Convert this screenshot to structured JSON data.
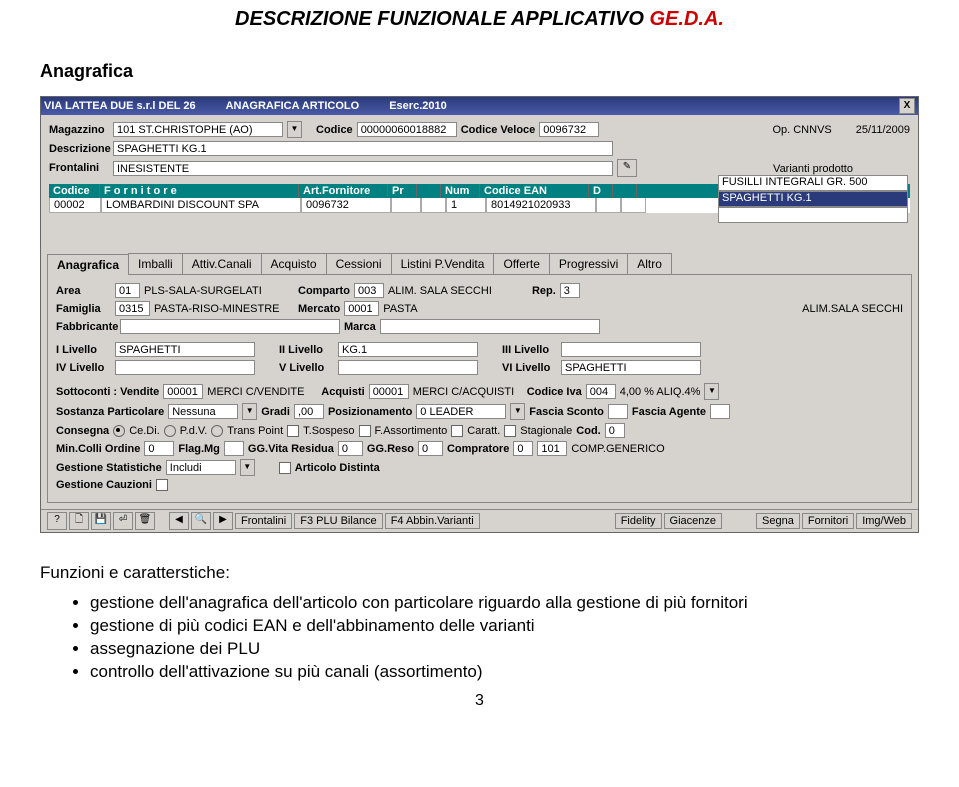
{
  "doc": {
    "title_plain": "DESCRIZIONE FUNZIONALE APPLICATIVO ",
    "title_em": "GE.D.A."
  },
  "section": "Anagrafica",
  "titlebar": {
    "company": "VIA LATTEA DUE s.r.l DEL 26",
    "module": "ANAGRAFICA ARTICOLO",
    "eserc": "Eserc.2010",
    "close": "X"
  },
  "top": {
    "magazzino_lbl": "Magazzino",
    "magazzino": "101 ST.CHRISTOPHE (AO)",
    "codice_lbl": "Codice",
    "codice": "00000060018882",
    "codvel_lbl": "Codice Veloce",
    "codvel": "0096732",
    "op": "Op. CNNVS",
    "data": "25/11/2009",
    "descr_lbl": "Descrizione",
    "descr": "SPAGHETTI KG.1",
    "front_lbl": "Frontalini",
    "front": "INESISTENTE",
    "edit": "✎"
  },
  "forntbl": {
    "h": [
      "Codice",
      "F o r n i t o r e",
      "Art.Fornitore",
      "Pr",
      "",
      "Num",
      "Codice EAN",
      "D",
      ""
    ],
    "r": [
      "00002",
      "LOMBARDINI DISCOUNT SPA",
      "0096732",
      "",
      "",
      "1",
      "8014921020933",
      "",
      ""
    ]
  },
  "variants": {
    "title": "Varianti prodotto",
    "items": [
      "FUSILLI INTEGRALI GR. 500",
      "SPAGHETTI KG.1"
    ]
  },
  "tabs": [
    "Anagrafica",
    "Imballi",
    "Attiv.Canali",
    "Acquisto",
    "Cessioni",
    "Listini P.Vendita",
    "Offerte",
    "Progressivi",
    "Altro"
  ],
  "panel": {
    "area_lbl": "Area",
    "area_c": "01",
    "area_d": "PLS-SALA-SURGELATI",
    "comp_lbl": "Comparto",
    "comp_c": "003",
    "comp_d": "ALIM. SALA SECCHI",
    "rep_lbl": "Rep.",
    "rep_c": "3",
    "fam_lbl": "Famiglia",
    "fam_c": "0315",
    "fam_d": "PASTA-RISO-MINESTRE",
    "merc_lbl": "Mercato",
    "merc_c": "0001",
    "merc_d": "PASTA",
    "rep_d": "ALIM.SALA SECCHI",
    "fabb_lbl": "Fabbricante",
    "marca_lbl": "Marca",
    "l1_lbl": "I Livello",
    "l1": "SPAGHETTI",
    "l2_lbl": "II Livello",
    "l2": "KG.1",
    "l3_lbl": "III Livello",
    "l3": "",
    "l4_lbl": "IV Livello",
    "l4": "",
    "l5_lbl": "V Livello",
    "l5": "",
    "l6_lbl": "VI Livello",
    "l6": "SPAGHETTI",
    "sott_lbl": "Sottoconti : Vendite",
    "sott_v_c": "00001",
    "sott_v_d": "MERCI C/VENDITE",
    "acq_lbl": "Acquisti",
    "acq_c": "00001",
    "acq_d": "MERCI C/ACQUISTI",
    "iva_lbl": "Codice Iva",
    "iva_c": "004",
    "iva_d": "4,00 % ALIQ.4%",
    "sost_lbl": "Sostanza Particolare",
    "sost": "Nessuna",
    "gradi_lbl": "Gradi",
    "gradi": ",00",
    "pos_lbl": "Posizionamento",
    "pos": "0 LEADER",
    "fsc_lbl": "Fascia Sconto",
    "fag_lbl": "Fascia Agente",
    "cons_lbl": "Consegna",
    "r1": "Ce.Di.",
    "r2": "P.d.V.",
    "r3": "Trans Point",
    "c1": "T.Sospeso",
    "c2": "F.Assortimento",
    "c3": "Caratt.",
    "c4": "Stagionale",
    "cod_lbl": "Cod.",
    "cod": "0",
    "min_lbl": "Min.Colli Ordine",
    "min": "0",
    "flag_lbl": "Flag.Mg",
    "ggv_lbl": "GG.Vita Residua",
    "ggv": "0",
    "ggr_lbl": "GG.Reso",
    "ggr": "0",
    "compr_lbl": "Compratore",
    "compr_c": "0",
    "compr_c2": "101",
    "compr_d": "COMP.GENERICO",
    "gstat_lbl": "Gestione Statistiche",
    "gstat": "Includi",
    "artd_lbl": "Articolo Distinta",
    "gcauz_lbl": "Gestione Cauzioni"
  },
  "botbar": {
    "b1": "Frontalini",
    "b2": "F3 PLU Bilance",
    "b3": "F4 Abbin.Varianti",
    "b4": "Fidelity",
    "b5": "Giacenze",
    "b6": "Segna",
    "b7": "Fornitori",
    "b8": "Img/Web"
  },
  "bullets": {
    "h": "Funzioni e caratterstiche:",
    "i": [
      "gestione dell'anagrafica dell'articolo con particolare riguardo alla gestione di più fornitori",
      "gestione di più codici EAN e dell'abbinamento delle varianti",
      "assegnazione dei PLU",
      "controllo dell'attivazione su più canali (assortimento)"
    ]
  },
  "page": "3"
}
